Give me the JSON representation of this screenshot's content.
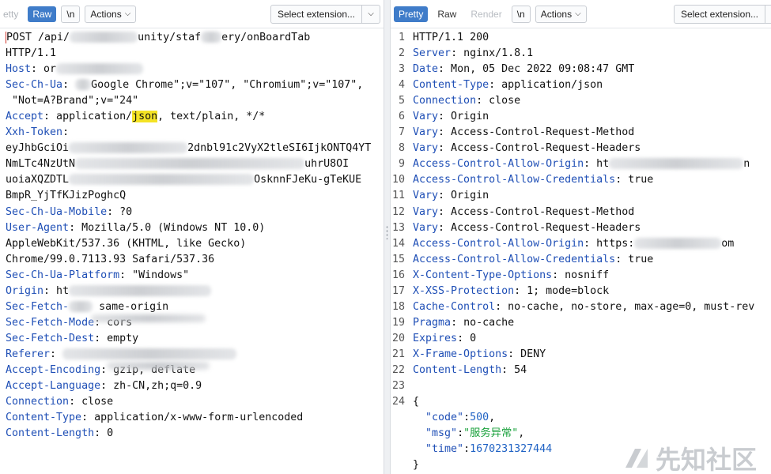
{
  "left": {
    "tabs": [
      "etty",
      "Raw",
      "\\n",
      "Actions"
    ],
    "select_extension": "Select extension...",
    "lines": [
      [
        {
          "t": "POST /api/",
          "c": "v"
        },
        {
          "blur": 86
        },
        {
          "t": "unity/staf",
          "c": "v"
        },
        {
          "blur": 26
        },
        {
          "t": "ery/onBoardTab",
          "c": "v"
        }
      ],
      [
        {
          "t": "HTTP/1.1",
          "c": "v"
        }
      ],
      [
        {
          "t": "Host",
          "c": "k"
        },
        {
          "t": ": or",
          "c": "v"
        },
        {
          "blur": 110
        }
      ],
      [
        {
          "t": "Sec-Ch-Ua",
          "c": "k"
        },
        {
          "t": ": ",
          "c": "v"
        },
        {
          "blur": 20
        },
        {
          "t": "Google Chrome\";v=\"107\", \"Chromium\";v=\"107\",",
          "c": "v"
        }
      ],
      [
        {
          "t": " \"Not=A?Brand\";v=\"24\"",
          "c": "v"
        }
      ],
      [
        {
          "t": "Accept",
          "c": "k"
        },
        {
          "t": ": application/",
          "c": "v"
        },
        {
          "t": "json",
          "c": "hl"
        },
        {
          "t": ", text/plain, */*",
          "c": "v"
        }
      ],
      [
        {
          "t": "Xxh-Token",
          "c": "k"
        },
        {
          "t": ":",
          "c": "v"
        }
      ],
      [
        {
          "t": "eyJhbGciOi",
          "c": "v"
        },
        {
          "blur": 150
        },
        {
          "t": "2dnbl91c2VyX2tleSI6IjkONTQ4YT",
          "c": "v"
        }
      ],
      [
        {
          "t": "NmLTc4NzUtN",
          "c": "v"
        },
        {
          "blur": 290
        },
        {
          "t": "uhrU8OI",
          "c": "v"
        }
      ],
      [
        {
          "t": "uoiaXQZDTL",
          "c": "v"
        },
        {
          "blur": 234
        },
        {
          "t": "OsknnFJeKu-gTeKUE",
          "c": "v"
        }
      ],
      [
        {
          "t": "BmpR_YjTfKJizPoghcQ",
          "c": "v"
        }
      ],
      [
        {
          "t": "Sec-Ch-Ua-Mobile",
          "c": "k"
        },
        {
          "t": ": ?0",
          "c": "v"
        }
      ],
      [
        {
          "t": "User-Agent",
          "c": "k"
        },
        {
          "t": ": Mozilla/5.0 (Windows NT 10.0)",
          "c": "v"
        }
      ],
      [
        {
          "t": "AppleWebKit/537.36 (KHTML, like Gecko)",
          "c": "v"
        }
      ],
      [
        {
          "t": "Chrome/99.0.7113.93 Safari/537.36",
          "c": "v"
        }
      ],
      [
        {
          "t": "Sec-Ch-Ua-Platform",
          "c": "k"
        },
        {
          "t": ": \"Windows\"",
          "c": "v"
        }
      ],
      [
        {
          "t": "Origin",
          "c": "k"
        },
        {
          "t": ": ht",
          "c": "v"
        },
        {
          "blur": 180
        }
      ],
      [
        {
          "t": "Sec-Fetch-",
          "c": "k"
        },
        {
          "blur": 30
        },
        {
          "t": " same-origin",
          "c": "v"
        }
      ],
      [
        {
          "t": "Sec-Fetch-Mode",
          "c": "k"
        },
        {
          "t": ": cors",
          "c": "v"
        }
      ],
      [
        {
          "t": "Sec-Fetch-Dest",
          "c": "k"
        },
        {
          "t": ": empty",
          "c": "v"
        }
      ],
      [
        {
          "t": "Referer",
          "c": "k"
        },
        {
          "t": ": ",
          "c": "v"
        },
        {
          "blur": 220
        }
      ],
      [
        {
          "t": "Accept-Encoding",
          "c": "k"
        },
        {
          "t": ": gzip, deflate",
          "c": "v"
        }
      ],
      [
        {
          "t": "Accept-Language",
          "c": "k"
        },
        {
          "t": ": zh-CN,zh;q=0.9",
          "c": "v"
        }
      ],
      [
        {
          "t": "Connection",
          "c": "k"
        },
        {
          "t": ": close",
          "c": "v"
        }
      ],
      [
        {
          "t": "Content-Type",
          "c": "k"
        },
        {
          "t": ": application/x-www-form-urlencoded",
          "c": "v"
        }
      ],
      [
        {
          "t": "Content-Length",
          "c": "k"
        },
        {
          "t": ": 0",
          "c": "v"
        }
      ]
    ]
  },
  "right": {
    "tabs": [
      "Pretty",
      "Raw",
      "Render",
      "\\n",
      "Actions"
    ],
    "select_extension": "Select extension...",
    "lines": [
      [
        {
          "t": "HTTP/1.1 200",
          "c": "v"
        }
      ],
      [
        {
          "t": "Server",
          "c": "k"
        },
        {
          "t": ": nginx/1.8.1",
          "c": "v"
        }
      ],
      [
        {
          "t": "Date",
          "c": "k"
        },
        {
          "t": ": Mon, 05 Dec 2022 09:08:47 GMT",
          "c": "v"
        }
      ],
      [
        {
          "t": "Content-Type",
          "c": "k"
        },
        {
          "t": ": application/json",
          "c": "v"
        }
      ],
      [
        {
          "t": "Connection",
          "c": "k"
        },
        {
          "t": ": close",
          "c": "v"
        }
      ],
      [
        {
          "t": "Vary",
          "c": "k"
        },
        {
          "t": ": Origin",
          "c": "v"
        }
      ],
      [
        {
          "t": "Vary",
          "c": "k"
        },
        {
          "t": ": Access-Control-Request-Method",
          "c": "v"
        }
      ],
      [
        {
          "t": "Vary",
          "c": "k"
        },
        {
          "t": ": Access-Control-Request-Headers",
          "c": "v"
        }
      ],
      [
        {
          "t": "Access-Control-Allow-Origin",
          "c": "k"
        },
        {
          "t": ": ht",
          "c": "v"
        },
        {
          "blur": 170
        },
        {
          "t": "n",
          "c": "v"
        }
      ],
      [
        {
          "t": "Access-Control-Allow-Credentials",
          "c": "k"
        },
        {
          "t": ": true",
          "c": "v"
        }
      ],
      [
        {
          "t": "Vary",
          "c": "k"
        },
        {
          "t": ": Origin",
          "c": "v"
        }
      ],
      [
        {
          "t": "Vary",
          "c": "k"
        },
        {
          "t": ": Access-Control-Request-Method",
          "c": "v"
        }
      ],
      [
        {
          "t": "Vary",
          "c": "k"
        },
        {
          "t": ": Access-Control-Request-Headers",
          "c": "v"
        }
      ],
      [
        {
          "t": "Access-Control-Allow-Origin",
          "c": "k"
        },
        {
          "t": ": https:",
          "c": "v"
        },
        {
          "blur": 110
        },
        {
          "t": "om",
          "c": "v"
        }
      ],
      [
        {
          "t": "Access-Control-Allow-Credentials",
          "c": "k"
        },
        {
          "t": ": true",
          "c": "v"
        }
      ],
      [
        {
          "t": "X-Content-Type-Options",
          "c": "k"
        },
        {
          "t": ": nosniff",
          "c": "v"
        }
      ],
      [
        {
          "t": "X-XSS-Protection",
          "c": "k"
        },
        {
          "t": ": 1; mode=block",
          "c": "v"
        }
      ],
      [
        {
          "t": "Cache-Control",
          "c": "k"
        },
        {
          "t": ": no-cache, no-store, max-age=0, must-rev",
          "c": "v"
        }
      ],
      [
        {
          "t": "Pragma",
          "c": "k"
        },
        {
          "t": ": no-cache",
          "c": "v"
        }
      ],
      [
        {
          "t": "Expires",
          "c": "k"
        },
        {
          "t": ": 0",
          "c": "v"
        }
      ],
      [
        {
          "t": "X-Frame-Options",
          "c": "k"
        },
        {
          "t": ": DENY",
          "c": "v"
        }
      ],
      [
        {
          "t": "Content-Length",
          "c": "k"
        },
        {
          "t": ": 54",
          "c": "v"
        }
      ],
      [],
      [
        {
          "t": "{",
          "c": "json-p"
        }
      ]
    ],
    "line_numbers": [
      "1",
      "2",
      "3",
      "4",
      "5",
      "6",
      "7",
      "8",
      "9",
      "10",
      "11",
      "12",
      "13",
      "14",
      "15",
      "16",
      "17",
      "18",
      "19",
      "20",
      "21",
      "22",
      "23",
      "24"
    ],
    "json_body": [
      [
        {
          "t": "  \"code\"",
          "c": "json-k"
        },
        {
          "t": ":",
          "c": "json-p"
        },
        {
          "t": "500",
          "c": "json-n"
        },
        {
          "t": ",",
          "c": "json-p"
        }
      ],
      [
        {
          "t": "  \"msg\"",
          "c": "json-k"
        },
        {
          "t": ":",
          "c": "json-p"
        },
        {
          "t": "\"服务异常\"",
          "c": "json-s"
        },
        {
          "t": ",",
          "c": "json-p"
        }
      ],
      [
        {
          "t": "  \"time\"",
          "c": "json-k"
        },
        {
          "t": ":",
          "c": "json-p"
        },
        {
          "t": "1670231327444",
          "c": "json-n"
        }
      ],
      [
        {
          "t": "}",
          "c": "json-p"
        }
      ]
    ]
  },
  "watermark": "先知社区",
  "colors": {
    "accent": "#3f7cc9",
    "key": "#1f4fb6",
    "highlight": "#f4e325",
    "json_string": "#1aa13c"
  }
}
